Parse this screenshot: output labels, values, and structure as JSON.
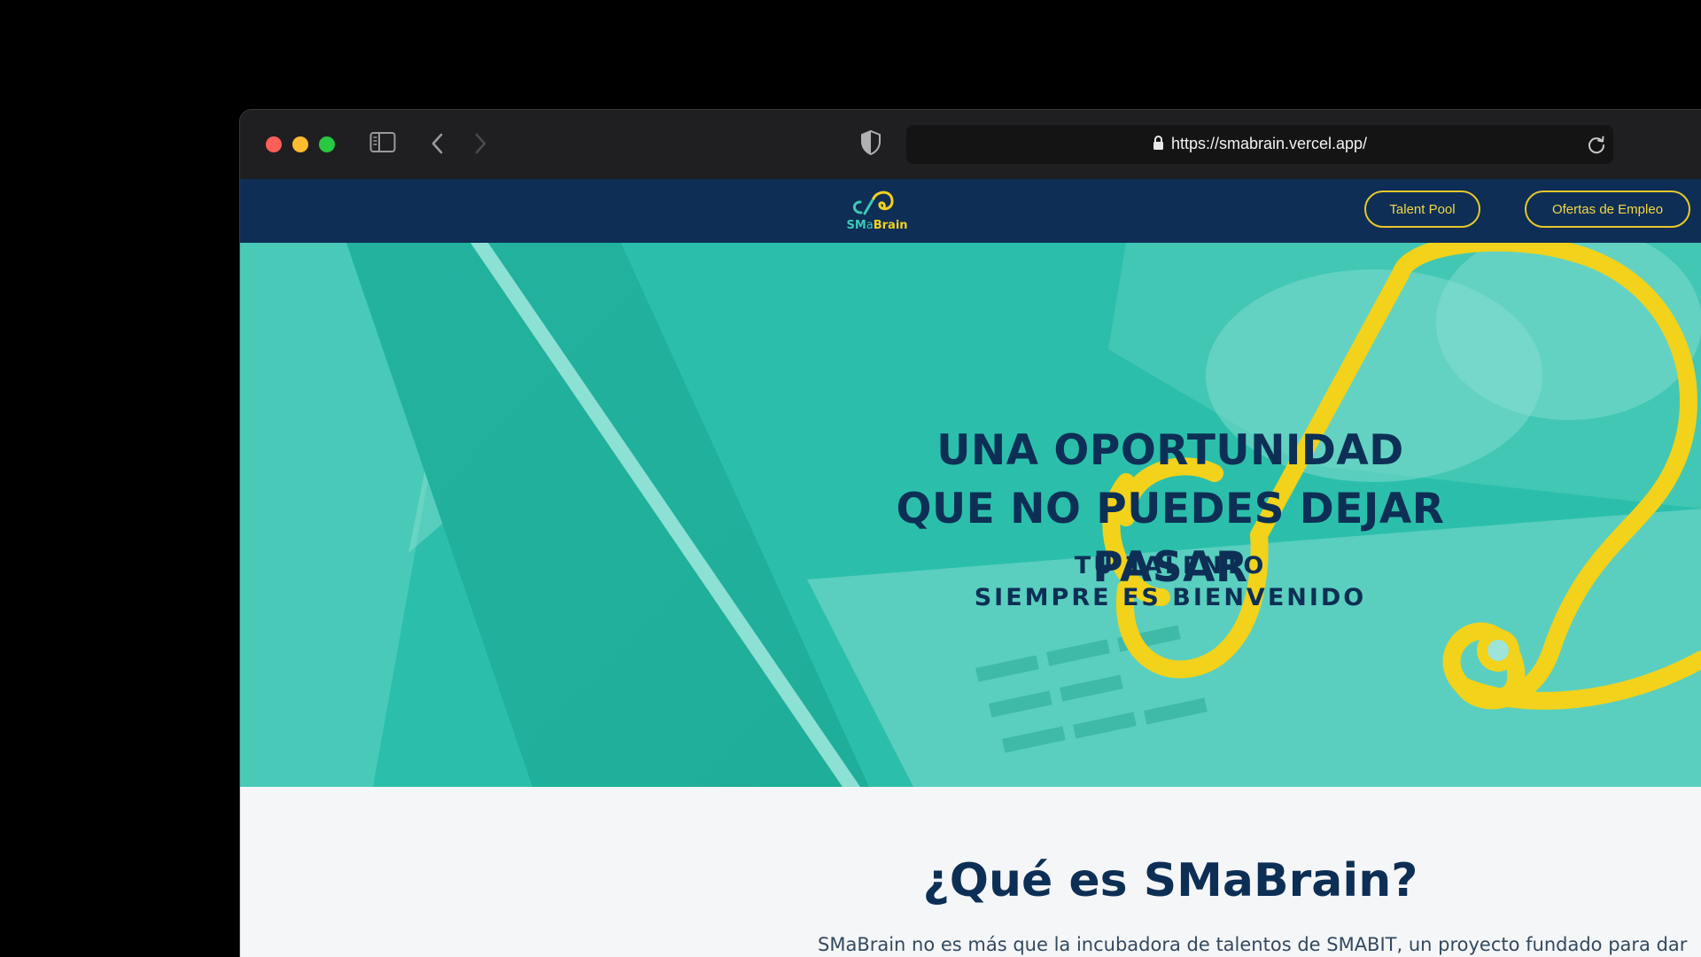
{
  "browser": {
    "url": "https://smabrain.vercel.app/",
    "icons": [
      "sidebar-icon",
      "back-arrow-icon",
      "forward-arrow-icon",
      "shield-icon",
      "lock-icon",
      "reload-icon"
    ]
  },
  "nav": {
    "logo_sm": "SM",
    "logo_ma": "a",
    "logo_brain": "Brain",
    "buttons": [
      "Talent Pool",
      "Ofertas de Empleo"
    ]
  },
  "hero": {
    "title_line1": "UNA OPORTUNIDAD",
    "title_line2": "QUE NO PUEDES DEJAR PASAR",
    "subtitle_line1": "TU TALENTO",
    "subtitle_line2": "SIEMPRE ES BIENVENIDO"
  },
  "about": {
    "title": "¿Qué es SMaBrain?",
    "text": "SMaBrain no es más que la incubadora de talentos de SMABIT, un proyecto fundado para dar"
  },
  "colors": {
    "navy": "#0e2e56",
    "teal": "#27bca8",
    "yellow": "#f2d21b",
    "background": "#f4f6f8"
  }
}
